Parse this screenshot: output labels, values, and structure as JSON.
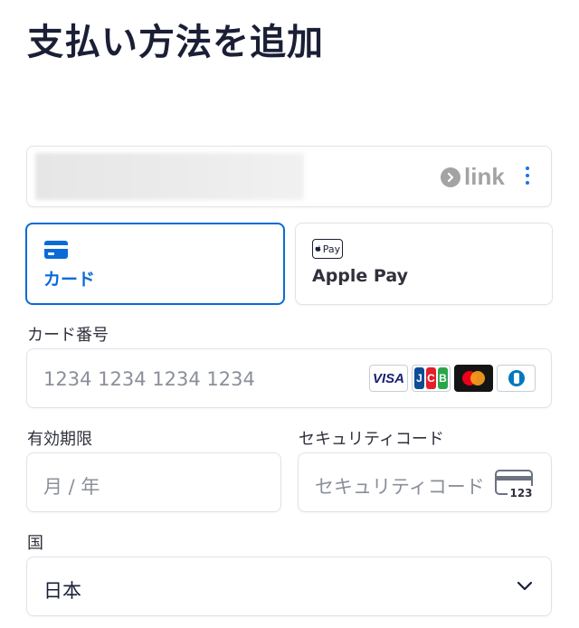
{
  "page": {
    "title": "支払い方法を追加"
  },
  "link": {
    "logo_text": "link"
  },
  "tabs": [
    {
      "label": "カード",
      "selected": true
    },
    {
      "label": "Apple Pay",
      "badge_text": "Pay",
      "selected": false
    }
  ],
  "card_number": {
    "label": "カード番号",
    "placeholder": "1234 1234 1234 1234"
  },
  "brands": {
    "visa": "VISA",
    "jcb": [
      "J",
      "C",
      "B"
    ]
  },
  "expiry": {
    "label": "有効期限",
    "placeholder": "月 / 年"
  },
  "cvc": {
    "label": "セキュリティコード",
    "placeholder": "セキュリティコード",
    "icon_text": "123"
  },
  "country": {
    "label": "国",
    "value": "日本"
  },
  "colors": {
    "accent": "#0a6bd7",
    "text": "#1a1f36",
    "border": "#dfe3e8",
    "placeholder": "#8a8f99"
  }
}
